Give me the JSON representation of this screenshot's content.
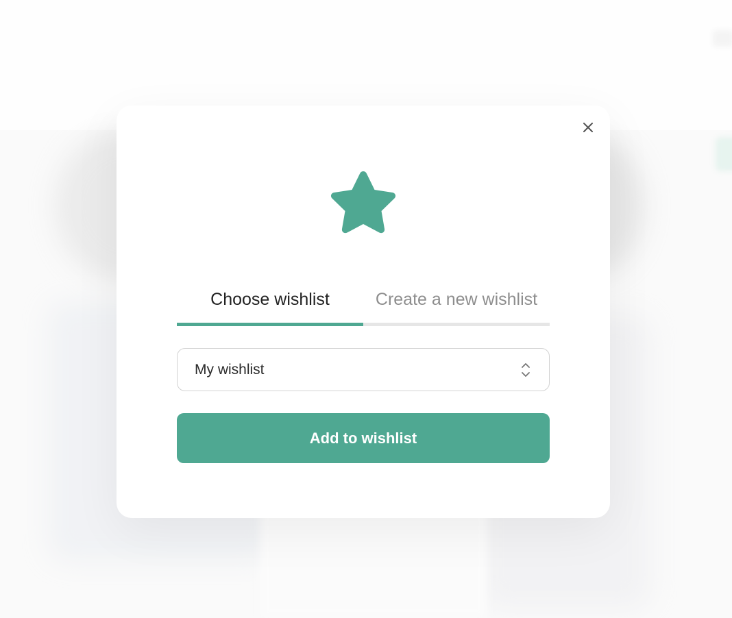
{
  "modal": {
    "close_icon": "close-icon",
    "header_icon": "star-icon",
    "accent_color": "#4fa892",
    "tabs": [
      {
        "label": "Choose wishlist",
        "active": true
      },
      {
        "label": "Create a new wishlist",
        "active": false
      }
    ],
    "wishlist_select": {
      "selected": "My wishlist",
      "icon": "chevron-up-down-icon"
    },
    "submit_label": "Add to wishlist"
  }
}
